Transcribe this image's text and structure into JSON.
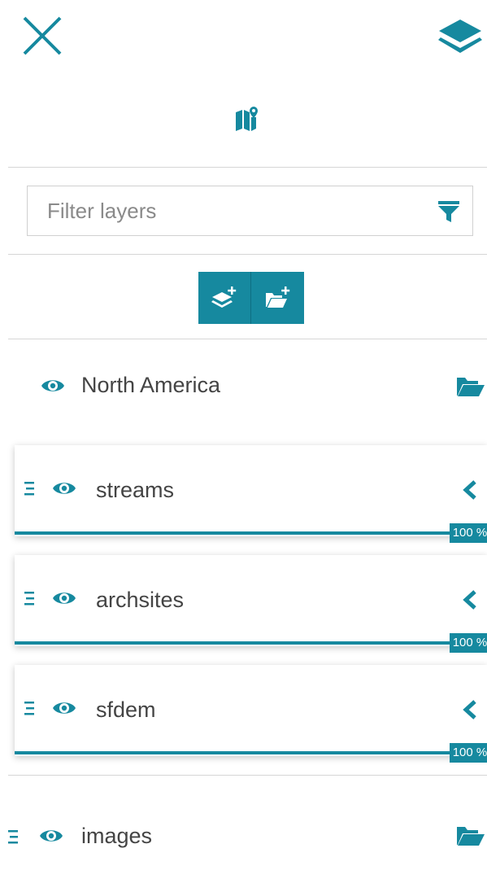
{
  "filter": {
    "placeholder": "Filter layers"
  },
  "groups": [
    {
      "label": "North America"
    },
    {
      "label": "images"
    }
  ],
  "layers": [
    {
      "label": "streams",
      "opacity": "100 %"
    },
    {
      "label": "archsites",
      "opacity": "100 %"
    },
    {
      "label": "sfdem",
      "opacity": "100 %"
    }
  ],
  "icons": {
    "close": "close-icon",
    "layers": "layers-icon",
    "map": "map-marker-icon",
    "filter": "funnel-icon",
    "add_layer": "add-layer-icon",
    "add_group": "add-folder-icon",
    "eye": "eye-icon",
    "folder": "folder-open-icon",
    "handle": "drag-handle-icon",
    "chevron": "chevron-left-icon"
  },
  "colors": {
    "accent": "#16899f",
    "divider": "#d6d6d6"
  }
}
